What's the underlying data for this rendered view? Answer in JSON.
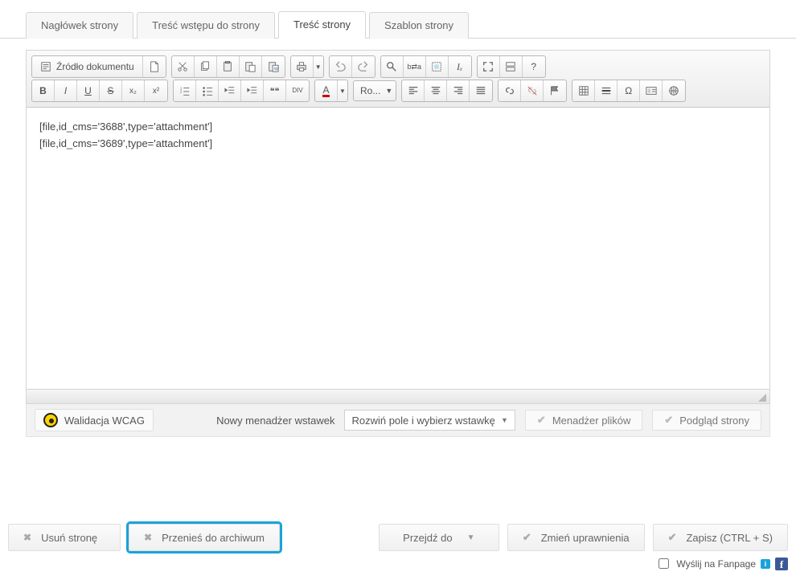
{
  "tabs": [
    {
      "label": "Nagłówek strony",
      "active": false
    },
    {
      "label": "Treść wstępu do strony",
      "active": false
    },
    {
      "label": "Treść strony",
      "active": true
    },
    {
      "label": "Szablon strony",
      "active": false
    }
  ],
  "toolbar": {
    "source_label": "Źródło dokumentu",
    "font_color_label": "A",
    "styles_label": "Ro...",
    "bold": "B",
    "italic": "I",
    "underline": "U",
    "strike": "S",
    "sub": "x₂",
    "sup": "x²",
    "quote": "❝❝",
    "div": "DIV",
    "abc": "ᴬᴮᶜ",
    "aba": "ᵃᵇₐ",
    "tx": "Iₓ",
    "omega": "Ω",
    "question": "?"
  },
  "editor": {
    "lines": [
      "[file,id_cms='3688',type='attachment']",
      "[file,id_cms='3689',type='attachment']"
    ]
  },
  "below": {
    "wcag_label": "Walidacja WCAG",
    "manager_label": "Nowy menadżer wstawek",
    "select_text": "Rozwiń pole i wybierz wstawkę",
    "file_manager": "Menadżer plików",
    "preview": "Podgląd strony"
  },
  "footer": {
    "delete": "Usuń stronę",
    "archive": "Przenieś do archiwum",
    "goto": "Przejdź do",
    "perms": "Zmień uprawnienia",
    "save": "Zapisz (CTRL + S)",
    "fanpage": "Wyślij na Fanpage"
  }
}
